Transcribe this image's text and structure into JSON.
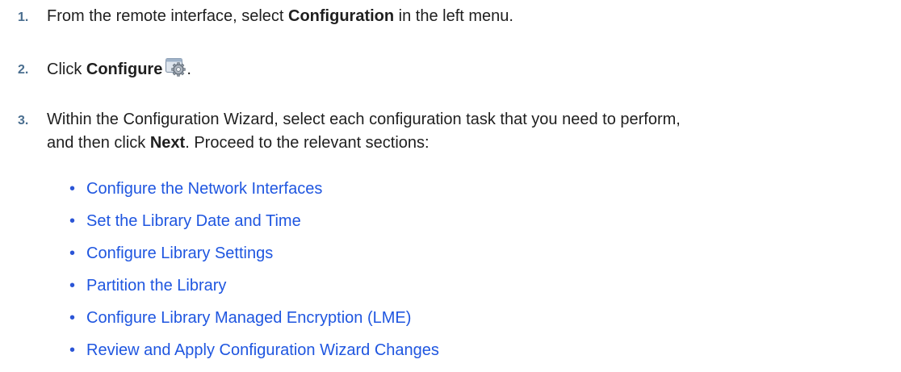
{
  "steps": [
    {
      "number": "1.",
      "before": "From the remote interface, select ",
      "bold": "Configuration",
      "after": " in the left menu."
    },
    {
      "number": "2.",
      "before": "Click ",
      "bold": "Configure",
      "icon": "configure-gear-icon",
      "after": "."
    },
    {
      "number": "3.",
      "line1_before": "Within the Configuration Wizard, select each configuration task that you need to perform,",
      "line2_before": "and then click ",
      "bold": "Next",
      "line2_after": ". Proceed to the relevant sections:"
    }
  ],
  "links": [
    "Configure the Network Interfaces",
    "Set the Library Date and Time",
    "Configure Library Settings",
    "Partition the Library",
    "Configure Library Managed Encryption (LME)",
    "Review and Apply Configuration Wizard Changes"
  ],
  "bullet_char": "•",
  "colors": {
    "link": "#1f56e0",
    "step_number": "#4a6e8f",
    "text": "#1f1f1f"
  }
}
